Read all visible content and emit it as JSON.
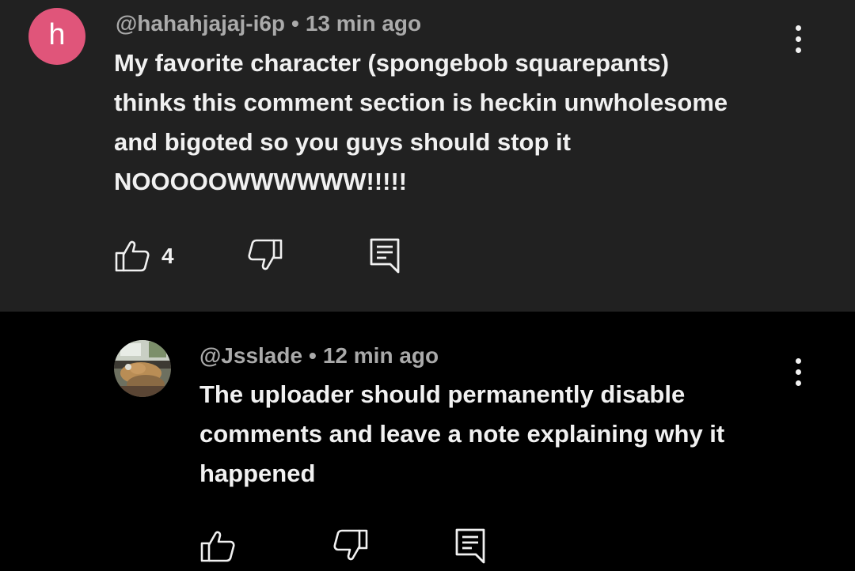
{
  "comments": [
    {
      "avatar_letter": "h",
      "avatar_color": "#e0557a",
      "username": "@hahahjajaj-i6p",
      "separator": "•",
      "time": "13 min ago",
      "lines": [
        "My favorite character (spongebob squarepants)",
        "thinks this comment section is heckin unwholesome",
        "and bigoted so you guys should stop it",
        "NOOOOOWWWWWW!!!!!"
      ],
      "like_count": "4",
      "icons": {
        "like": "thumbs-up-icon",
        "dislike": "thumbs-down-icon",
        "reply": "reply-icon",
        "menu": "more-vert-icon"
      }
    },
    {
      "avatar_image": "photo-avatar",
      "username": "@Jsslade",
      "separator": "•",
      "time": "12 min ago",
      "lines": [
        "The uploader should permanently disable",
        "comments and leave a note explaining why it",
        "happened"
      ],
      "like_count": "",
      "icons": {
        "like": "thumbs-up-icon",
        "dislike": "thumbs-down-icon",
        "reply": "reply-icon",
        "menu": "more-vert-icon"
      }
    }
  ],
  "colors": {
    "comment_highlight_bg": "#212121",
    "page_bg": "#000000",
    "text": "#f1f1f1",
    "meta": "#aaaaaa"
  }
}
